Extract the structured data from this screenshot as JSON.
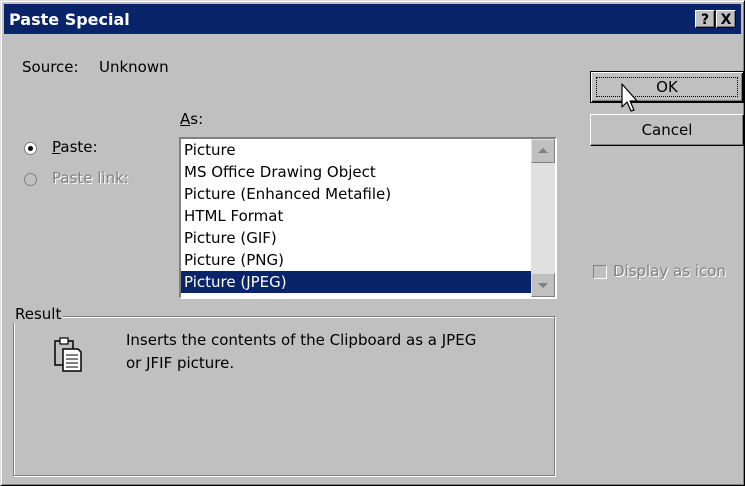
{
  "dialog": {
    "title": "Paste Special",
    "help_button": "?",
    "close_button": "X"
  },
  "source": {
    "label": "Source:",
    "value": "Unknown"
  },
  "as_label": "As:",
  "options": {
    "paste_label": "Paste:",
    "paste_link_label": "Paste link:",
    "paste_selected": true,
    "paste_link_enabled": false
  },
  "list": {
    "items": [
      "Picture",
      "MS Office Drawing Object",
      "Picture (Enhanced Metafile)",
      "HTML Format",
      "Picture (GIF)",
      "Picture (PNG)",
      "Picture (JPEG)"
    ],
    "selected_index": 6
  },
  "buttons": {
    "ok": "OK",
    "cancel": "Cancel"
  },
  "display_as_icon": {
    "label": "Display as icon",
    "checked": false,
    "enabled": false
  },
  "result": {
    "label": "Result",
    "line1": "Inserts the contents of the Clipboard as a JPEG",
    "line2": "or JFIF picture."
  },
  "colors": {
    "titlebar": "#0a246a",
    "selection": "#0a246a",
    "face": "#c0c0c0"
  }
}
